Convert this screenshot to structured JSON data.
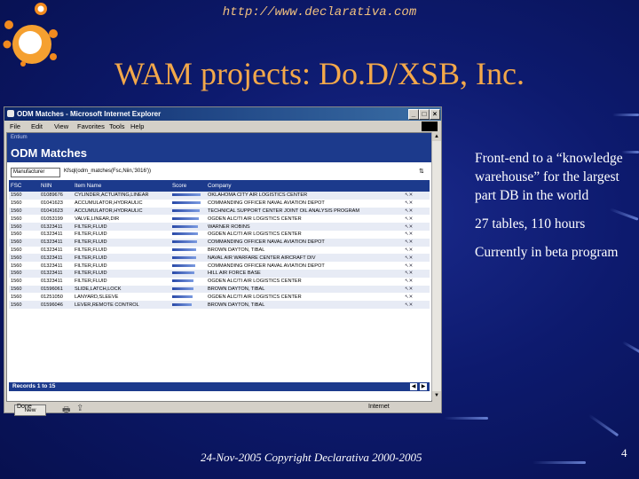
{
  "slide": {
    "url": "http://www.declarativa.com",
    "title": "WAM projects: Do.D/XSB, Inc.",
    "bullets": [
      "Front-end to a “knowledge warehouse” for the largest part DB in the world",
      "27 tables, 110 hours",
      "Currently in beta program"
    ],
    "footer": "24-Nov-2005 Copyright Declarativa 2000-2005",
    "page_number": "4"
  },
  "browser": {
    "title": "ODM Matches - Microsoft Internet Explorer",
    "menu": [
      "File",
      "Edit",
      "View",
      "Favorites",
      "Tools",
      "Help"
    ],
    "status_left": "Done",
    "status_right": "Internet"
  },
  "app": {
    "breadcrumb": "Entium",
    "heading": "ODM Matches",
    "filter_select": "Manufacturer",
    "filter_query": "Kfsql(odm_matches(Fsc,Niin,'3016'))",
    "columns": [
      "FSC",
      "NIIN",
      "Item Name",
      "Score",
      "Company",
      ""
    ],
    "rows": [
      {
        "fsc": "1560",
        "niin": "01089676",
        "item": "CYLINDER,ACTUATING,LINEAR",
        "score": 0.9,
        "company": "OKLAHOMA CITY AIR LOGISTICS CENTER",
        "actions": "↖✕"
      },
      {
        "fsc": "1560",
        "niin": "01041623",
        "item": "ACCUMULATOR,HYDRAULIC",
        "score": 0.88,
        "company": "COMMANDING OFFICER NAVAL AVIATION DEPOT",
        "actions": "↖✕"
      },
      {
        "fsc": "1560",
        "niin": "01041623",
        "item": "ACCUMULATOR,HYDRAULIC",
        "score": 0.86,
        "company": "TECHNICAL SUPPORT CENTER JOINT OIL ANALYSIS PROGRAM",
        "actions": "↖✕"
      },
      {
        "fsc": "1560",
        "niin": "01053199",
        "item": "VALVE,LINEAR,DIR",
        "score": 0.84,
        "company": "OGDEN ALC/TI AIR LOGISTICS CENTER",
        "actions": "↖✕"
      },
      {
        "fsc": "1560",
        "niin": "01323411",
        "item": "FILTER,FLUID",
        "score": 0.8,
        "company": "WARNER ROBINS",
        "actions": "↖✕"
      },
      {
        "fsc": "1560",
        "niin": "01323411",
        "item": "FILTER,FLUID",
        "score": 0.8,
        "company": "OGDEN ALC/TI AIR LOGISTICS CENTER",
        "actions": "↖✕"
      },
      {
        "fsc": "1560",
        "niin": "01323411",
        "item": "FILTER,FLUID",
        "score": 0.78,
        "company": "COMMANDING OFFICER NAVAL AVIATION DEPOT",
        "actions": "↖✕"
      },
      {
        "fsc": "1560",
        "niin": "01323411",
        "item": "FILTER,FLUID",
        "score": 0.76,
        "company": "BROWN DAYTON, TIBAL",
        "actions": "↖✕"
      },
      {
        "fsc": "1560",
        "niin": "01323411",
        "item": "FILTER,FLUID",
        "score": 0.74,
        "company": "NAVAL AIR WARFARE CENTER AIRCRAFT DIV",
        "actions": "↖✕"
      },
      {
        "fsc": "1560",
        "niin": "01323411",
        "item": "FILTER,FLUID",
        "score": 0.72,
        "company": "COMMANDING OFFICER NAVAL AVIATION DEPOT",
        "actions": "↖✕"
      },
      {
        "fsc": "1560",
        "niin": "01323411",
        "item": "FILTER,FLUID",
        "score": 0.7,
        "company": "HILL AIR FORCE BASE",
        "actions": "↖✕"
      },
      {
        "fsc": "1560",
        "niin": "01323411",
        "item": "FILTER,FLUID",
        "score": 0.68,
        "company": "OGDEN ALC/TI AIR LOGISTICS CENTER",
        "actions": "↖✕"
      },
      {
        "fsc": "1560",
        "niin": "01596061",
        "item": "SLIDE,LATCH,LOCK",
        "score": 0.66,
        "company": "BROWN DAYTON, TIBAL",
        "actions": "↖✕"
      },
      {
        "fsc": "1560",
        "niin": "01251050",
        "item": "LANYARD,SLEEVE",
        "score": 0.64,
        "company": "OGDEN ALC/TI AIR LOGISTICS CENTER",
        "actions": "↖✕"
      },
      {
        "fsc": "1560",
        "niin": "01596046",
        "item": "LEVER,REMOTE CONTROL",
        "score": 0.62,
        "company": "BROWN DAYTON, TIBAL",
        "actions": "↖✕"
      }
    ],
    "records_label": "Records 1 to 15",
    "new_button": "New"
  },
  "colors": {
    "title": "#f3a84a",
    "url": "#f0c080",
    "app_header": "#1c3a8c",
    "slide_bg": "#0d1a6e"
  }
}
